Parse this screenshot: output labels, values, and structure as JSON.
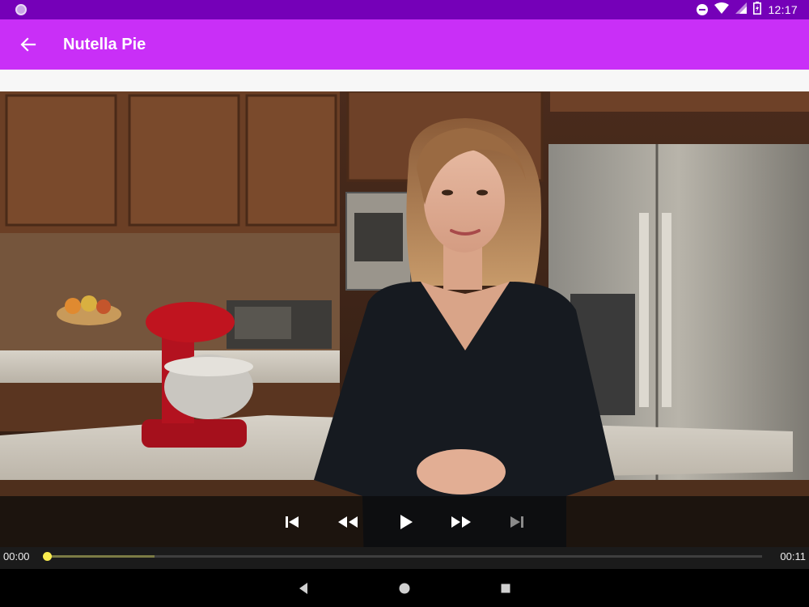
{
  "status_bar": {
    "time": "12:17",
    "icons": [
      "notification-dot-icon",
      "do-not-disturb-icon",
      "wifi-icon",
      "cell-signal-icon",
      "battery-charging-icon"
    ]
  },
  "app_bar": {
    "title": "Nutella Pie",
    "back_icon": "arrow-back-icon",
    "color": "#c92ff7"
  },
  "status_color": "#7500b8",
  "player": {
    "controls": [
      {
        "name": "previous",
        "icon": "skip-previous-icon",
        "enabled": true
      },
      {
        "name": "rewind",
        "icon": "rewind-icon",
        "enabled": true
      },
      {
        "name": "play",
        "icon": "play-icon",
        "enabled": true
      },
      {
        "name": "fast-forward",
        "icon": "fast-forward-icon",
        "enabled": true
      },
      {
        "name": "next",
        "icon": "skip-next-icon",
        "enabled": false
      }
    ],
    "position": "00:00",
    "duration": "00:11",
    "played_fraction": 0.0,
    "buffered_fraction": 0.15,
    "accent_color": "#f9ec4f"
  },
  "nav_bar": {
    "buttons": [
      "back-triangle-icon",
      "home-circle-icon",
      "recents-square-icon"
    ]
  }
}
